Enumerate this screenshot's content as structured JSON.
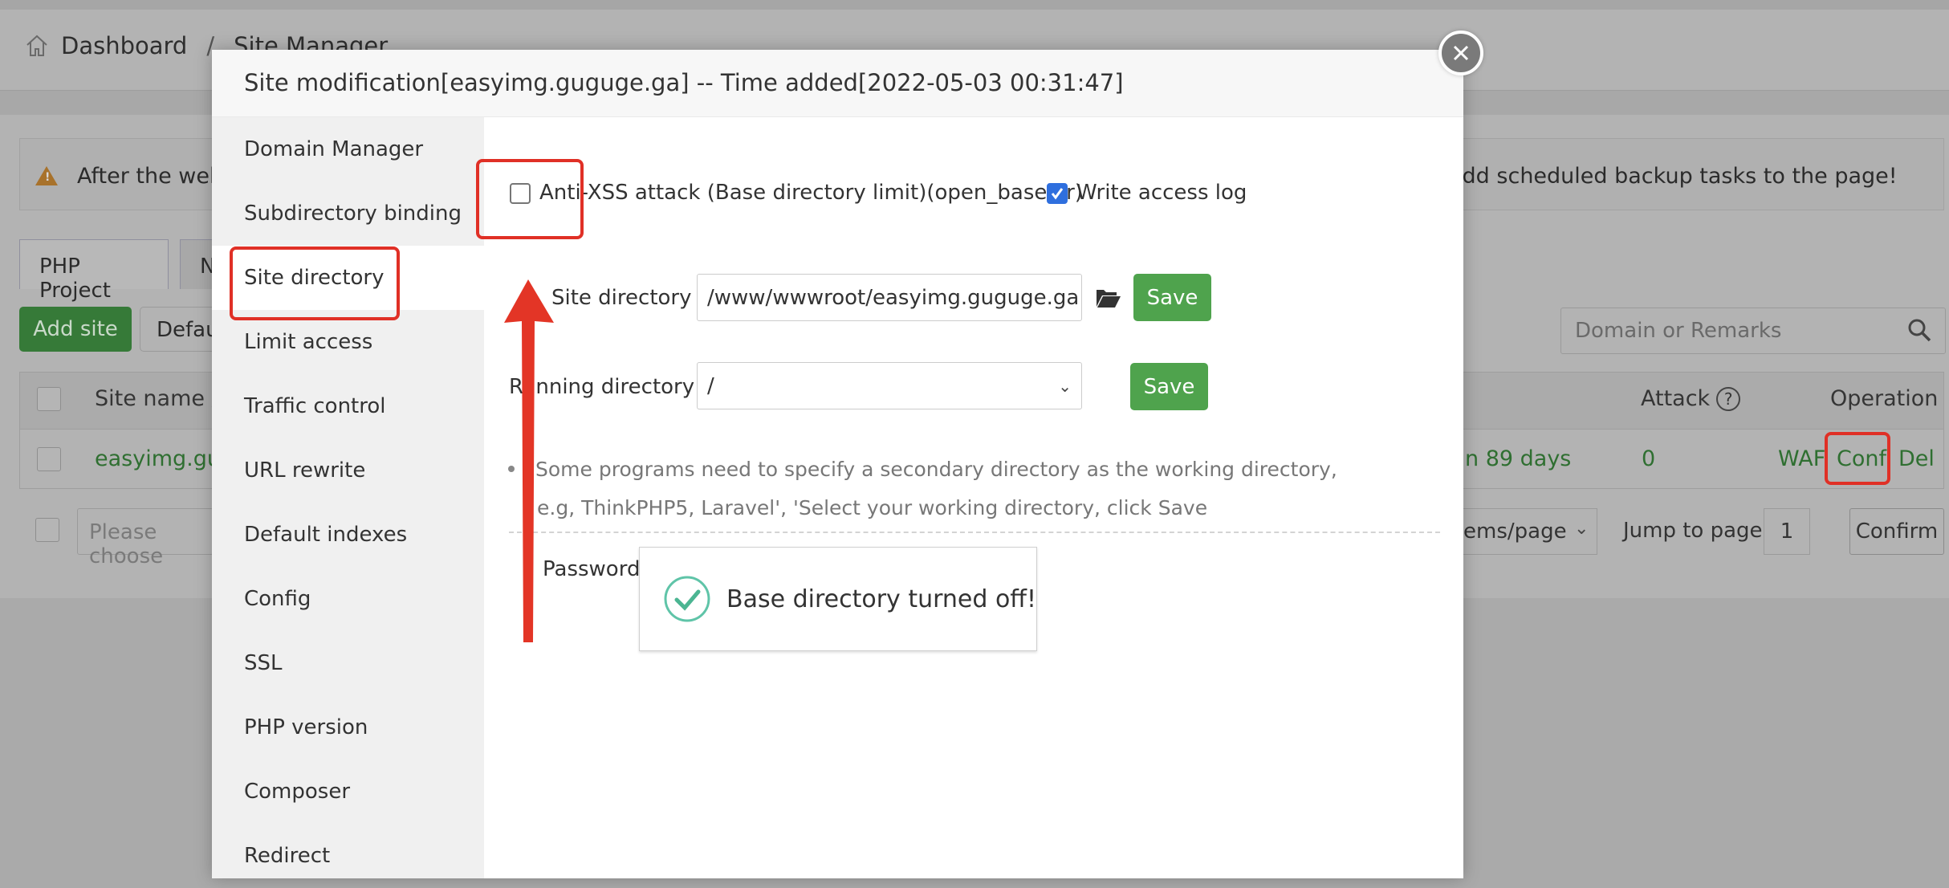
{
  "background": {
    "breadcrumb": [
      "Dashboard",
      "Site Manager"
    ],
    "breadcrumb_separator": "/",
    "banner": {
      "text_left": "After the webs",
      "text_right": "add scheduled backup tasks to the page!",
      "icon": "warning-icon"
    },
    "tabs": [
      "PHP Project",
      "N"
    ],
    "buttons": {
      "add_site": "Add site",
      "default": "Defau"
    },
    "search": {
      "placeholder": "Domain or Remarks"
    },
    "table": {
      "headers": {
        "site_name": "Site name",
        "attack": "Attack",
        "operation": "Operation"
      },
      "rows": [
        {
          "site_name": "easyimg.gug",
          "expiry": "n 89 days",
          "attack": "0",
          "ops": [
            "WAF",
            "Conf",
            "Del"
          ]
        }
      ]
    },
    "pager": {
      "batch_placeholder": "Please choose",
      "items_per_page": "ems/page",
      "jump_label": "Jump to page",
      "page": "1",
      "confirm": "Confirm"
    }
  },
  "modal": {
    "title": "Site modification[easyimg.guguge.ga] -- Time added[2022-05-03 00:31:47]",
    "sidebar": [
      {
        "label": "Domain Manager",
        "active": false
      },
      {
        "label": "Subdirectory binding",
        "active": false
      },
      {
        "label": "Site directory",
        "active": true
      },
      {
        "label": "Limit access",
        "active": false
      },
      {
        "label": "Traffic control",
        "active": false
      },
      {
        "label": "URL rewrite",
        "active": false
      },
      {
        "label": "Default indexes",
        "active": false
      },
      {
        "label": "Config",
        "active": false
      },
      {
        "label": "SSL",
        "active": false
      },
      {
        "label": "PHP version",
        "active": false
      },
      {
        "label": "Composer",
        "active": false
      },
      {
        "label": "Redirect",
        "active": false
      }
    ],
    "options": {
      "anti_xss": {
        "label": "Anti-XSS attack (Base directory limit)(open_basedir)",
        "checked": false
      },
      "write_log": {
        "label": "Write access log",
        "checked": true
      }
    },
    "site_directory": {
      "label": "Site directory",
      "value": "/www/wwwroot/easyimg.guguge.ga",
      "save": "Save"
    },
    "running_directory": {
      "label": "Running directory",
      "value": "/",
      "save": "Save"
    },
    "tips": [
      "Some programs need to specify a secondary directory as the working directory,",
      "e.g, ThinkPHP5, Laravel', 'Select your working directory, click Save"
    ],
    "password_label": "Password a",
    "toast": {
      "message": "Base directory turned off!",
      "icon": "success-check-icon"
    }
  },
  "colors": {
    "save_green": "#4fa34d",
    "highlight_red": "#e03026",
    "checkbox_blue": "#2f6fde",
    "link_green": "#2f6f31"
  }
}
